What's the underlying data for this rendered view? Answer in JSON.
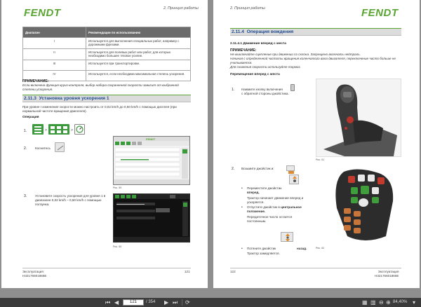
{
  "left_page": {
    "logo": "FENDT",
    "section_header": "2. Принцип работы",
    "table": {
      "headers": [
        "Диапазон",
        "Рекомендации по использованию"
      ],
      "rows": [
        [
          "I",
          "Используется для выполнения специальных работ, например с дорожными фрезами."
        ],
        [
          "II",
          "Используется для полевых работ или работ, для которых необходимо большее тяговое усилие."
        ],
        [
          "III",
          "Используется при транспортировке."
        ],
        [
          "IV",
          "Используется, если необходима максимальная степень ускорения."
        ]
      ]
    },
    "note_title": "ПРИМЕЧАНИЕ:",
    "note_text": "Если включена функция круиз-контроля, выбор набора сохраненной скорости зависит от выбранной степени ускорения.",
    "section_number": "2.11.3",
    "section_title": "Установка уровня ускорения 1",
    "intro_text": "При уровне I изменение скорости можно настроить от 0,02 km/h до 0,50 km/h с помощью дисплея (при нормальной частоте вращения двигателя).",
    "operation_label": "Операция",
    "step1_num": "1.",
    "step2_num": "2.",
    "step2_text": "Коснитесь",
    "step3_num": "3.",
    "step3_text": "Установите скорость ускорения для уровня 1 в диапазоне 0,02 km/h – 0,50 km/h с помощью ползунка.",
    "fig1_caption": "Рис. 59",
    "fig2_caption": "Рис. 60",
    "footer_left1": "Эксплуатация",
    "footer_left2": "H32176601866E",
    "page_number": "121"
  },
  "right_page": {
    "logo": "FENDT",
    "section_header": "2. Принцип работы",
    "section_number": "2.11.4",
    "section_title": "Операция вождения",
    "subsection": "2.11.4.1  Движение вперед с места",
    "note_title": "ПРИМЕЧАНИЕ:",
    "note_lines": [
      "Не выключайте сцепление при движении со склона. Запрещено включать нейтраль.",
      "Начиная с определенной частоты вращения коленчатого вала двигателя, переключение часто больше не учитывается.",
      "Для снижения скорости используйте тормоз."
    ],
    "sub_heading": "Перемещение вперед с места",
    "step1_num": "1.",
    "step1_text": "Нажмите кнопку включения",
    "step1_text2": "с обратной стороны джойстика.",
    "fig1_caption": "Рис. 61",
    "step2_num": "2.",
    "step2_text": "Возьмите джойстик и:",
    "bullet1_a": "Переместите джойстик",
    "bullet1_b": "вперед.",
    "bullet1_c": "Трактор начинает движение вперед и ускоряется.",
    "bullet2_a": "Отпустите джойстик в",
    "bullet2_b": "центральное",
    "bullet2_c": "положение.",
    "bullet2_d": "Передаточное число остается постоянным.",
    "bullet3_a": "Потяните джойстик",
    "bullet3_b": "назад.",
    "bullet3_c": "Трактор замедляется.",
    "fig2_caption": "Рис. 62",
    "footer_right1": "Эксплуатация",
    "footer_right2": "H32176601866E",
    "page_number": "122"
  },
  "toolbar": {
    "current_page": "121",
    "total_pages": "/ 354",
    "zoom": "84,40%"
  },
  "colors": {
    "brand_green": "#5aa532",
    "section_blue": "#1f4b8f",
    "toolbar_bg": "#3b3b3b"
  }
}
